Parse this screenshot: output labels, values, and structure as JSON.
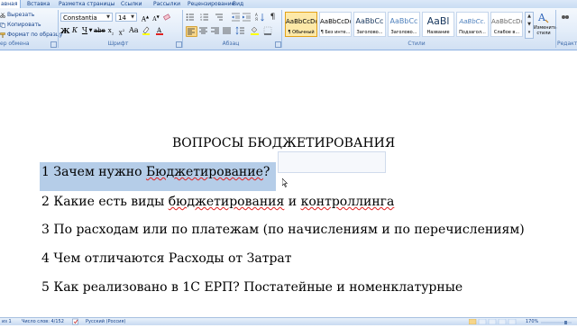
{
  "tabs": [
    "авная",
    "Вставка",
    "Разметка страницы",
    "Ссылки",
    "Рассылки",
    "Рецензирование",
    "Вид"
  ],
  "clipboard": {
    "cut": "Вырезать",
    "copy": "Копировать",
    "format_painter": "Формат по образцу",
    "label": "ер обмена"
  },
  "font": {
    "name": "Constantia",
    "size": "14",
    "label": "Шрифт"
  },
  "paragraph": {
    "label": "Абзац"
  },
  "styles": {
    "label": "Стили",
    "cards": [
      {
        "sample": "AaBbCcDc",
        "caption": "¶ Обычный",
        "selected": true
      },
      {
        "sample": "AaBbCcDc",
        "caption": "¶ Без инте..."
      },
      {
        "sample": "AaBbCc",
        "caption": "Заголово..."
      },
      {
        "sample": "AaBbCc",
        "caption": "Заголово..."
      },
      {
        "sample": "AaBl",
        "caption": "Название"
      },
      {
        "sample": "AaBbCc.",
        "caption": "Подзагол..."
      },
      {
        "sample": "AaBbCcDc",
        "caption": "Слабое в..."
      }
    ],
    "change_styles": "Изменить стили",
    "edit_label": "Редакт"
  },
  "document": {
    "title": "ВОПРОСЫ БЮДЖЕТИРОВАНИЯ",
    "line1_a": "1 Зачем нужно ",
    "line1_b": "Бюджетирование",
    "line1_c": "?",
    "line2_a": "2 Какие есть виды ",
    "line2_b": "бюджетирования",
    "line2_c": " и ",
    "line2_d": "контроллинга",
    "line3": "3 По расходам или по платежам (по начислениям и по перечислениям)",
    "line4": "4 Чем отличаются Расходы от Затрат",
    "line5": "5 Как реализовано в 1С ЕРП? Постатейные и номенклатурные"
  },
  "statusbar": {
    "page": "из 1",
    "words": "Число слов: 4/152",
    "language": "Русский (Россия)",
    "zoom": "170%"
  }
}
